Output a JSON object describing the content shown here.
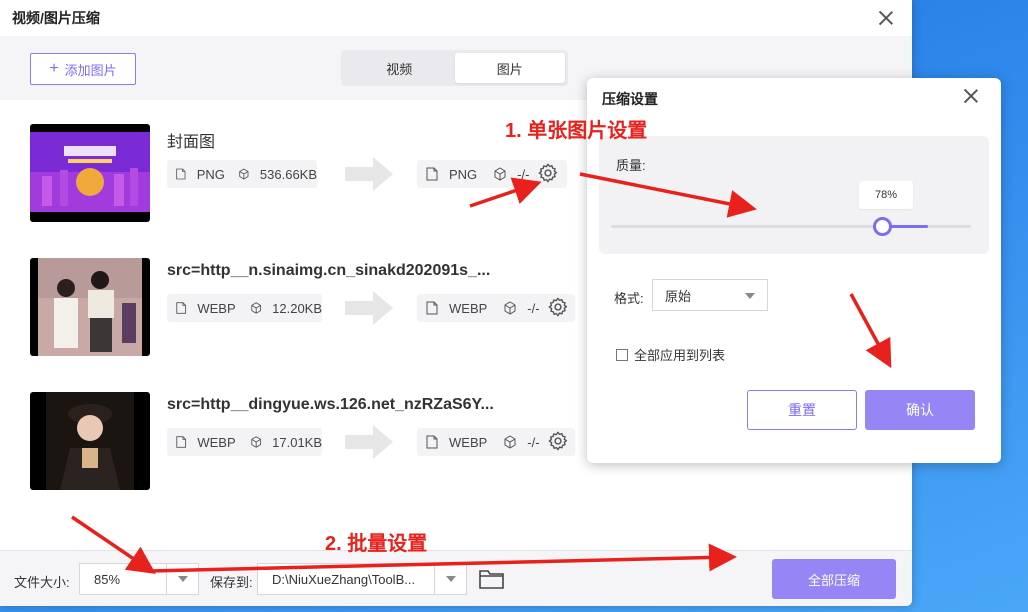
{
  "window": {
    "title": "视频/图片压缩"
  },
  "toolbar": {
    "add_label": "添加图片",
    "tabs": [
      {
        "label": "视频"
      },
      {
        "label": "图片"
      }
    ]
  },
  "files": [
    {
      "name": "封面图",
      "src_format": "PNG",
      "src_size": "536.66KB",
      "dst_format": "PNG",
      "dst_size": "-/-"
    },
    {
      "name": "src=http__n.sinaimg.cn_sinakd202091s_...",
      "src_format": "WEBP",
      "src_size": "12.20KB",
      "dst_format": "WEBP",
      "dst_size": "-/-"
    },
    {
      "name": "src=http__dingyue.ws.126.net_nzRZaS6Y...",
      "src_format": "WEBP",
      "src_size": "17.01KB",
      "dst_format": "WEBP",
      "dst_size": "-/-"
    }
  ],
  "bottom": {
    "size_label": "文件大小:",
    "size_value": "85%",
    "save_label": "保存到:",
    "save_path": "D:\\NiuXueZhang\\ToolB...",
    "compress_all": "全部压缩"
  },
  "dialog": {
    "title": "压缩设置",
    "quality_label": "质量:",
    "quality_value": "78%",
    "quality_fraction": 0.78,
    "format_label": "格式:",
    "format_value": "原始",
    "apply_all_label": "全部应用到列表",
    "reset_label": "重置",
    "confirm_label": "确认"
  },
  "annotations": {
    "single": "1. 单张图片设置",
    "batch": "2. 批量设置"
  },
  "colors": {
    "accent": "#7c6cf0",
    "button": "#9585f5",
    "annotation": "#e8211c"
  }
}
